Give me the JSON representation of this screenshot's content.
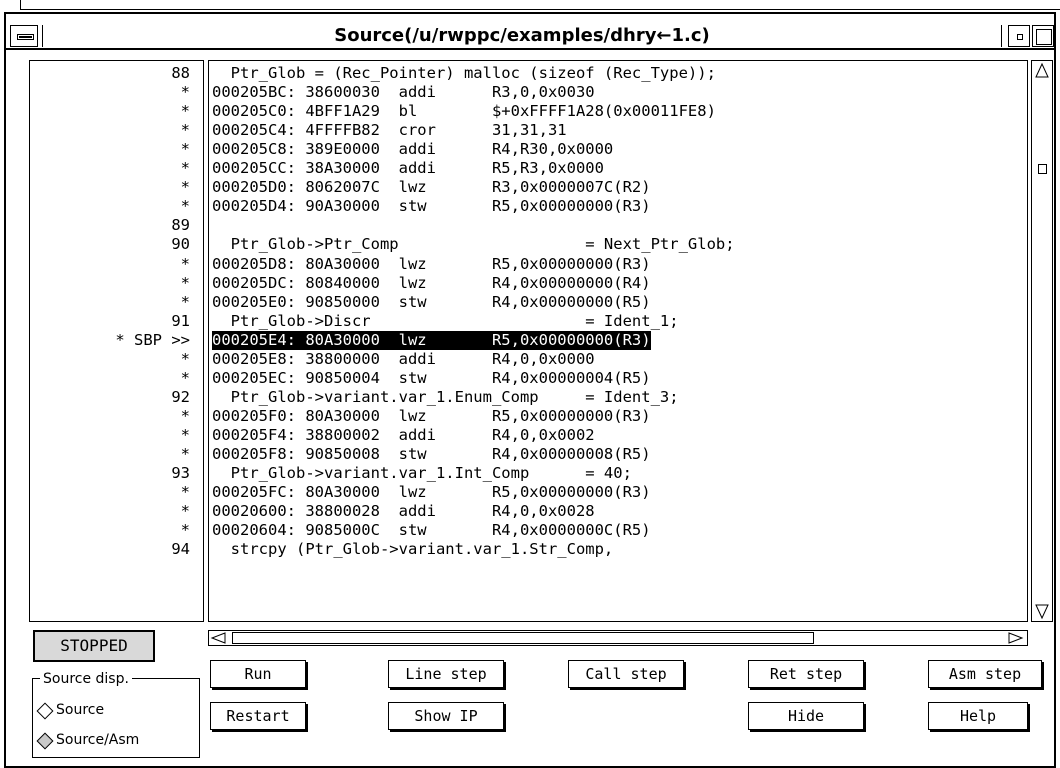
{
  "window": {
    "title": "Source(/u/rwppc/examples/dhry←1.c)"
  },
  "status": "STOPPED",
  "lines": [
    {
      "num": "88",
      "code": "  Ptr_Glob = (Rec_Pointer) malloc (sizeof (Rec_Type));"
    },
    {
      "num": "*",
      "code": "000205BC: 38600030  addi      R3,0,0x0030"
    },
    {
      "num": "*",
      "code": "000205C0: 4BFF1A29  bl        $+0xFFFF1A28(0x00011FE8)"
    },
    {
      "num": "*",
      "code": "000205C4: 4FFFFB82  cror      31,31,31"
    },
    {
      "num": "*",
      "code": "000205C8: 389E0000  addi      R4,R30,0x0000"
    },
    {
      "num": "*",
      "code": "000205CC: 38A30000  addi      R5,R3,0x0000"
    },
    {
      "num": "*",
      "code": "000205D0: 8062007C  lwz       R3,0x0000007C(R2)"
    },
    {
      "num": "*",
      "code": "000205D4: 90A30000  stw       R5,0x00000000(R3)"
    },
    {
      "num": "89",
      "code": ""
    },
    {
      "num": "90",
      "code": "  Ptr_Glob->Ptr_Comp                    = Next_Ptr_Glob;"
    },
    {
      "num": "*",
      "code": "000205D8: 80A30000  lwz       R5,0x00000000(R3)"
    },
    {
      "num": "*",
      "code": "000205DC: 80840000  lwz       R4,0x00000000(R4)"
    },
    {
      "num": "*",
      "code": "000205E0: 90850000  stw       R4,0x00000000(R5)"
    },
    {
      "num": "91",
      "code": "  Ptr_Glob->Discr                       = Ident_1;"
    },
    {
      "num": "* SBP >>",
      "code": "000205E4: 80A30000  lwz       R5,0x00000000(R3)",
      "highlight": true
    },
    {
      "num": "*",
      "code": "000205E8: 38800000  addi      R4,0,0x0000"
    },
    {
      "num": "*",
      "code": "000205EC: 90850004  stw       R4,0x00000004(R5)"
    },
    {
      "num": "92",
      "code": "  Ptr_Glob->variant.var_1.Enum_Comp     = Ident_3;"
    },
    {
      "num": "*",
      "code": "000205F0: 80A30000  lwz       R5,0x00000000(R3)"
    },
    {
      "num": "*",
      "code": "000205F4: 38800002  addi      R4,0,0x0002"
    },
    {
      "num": "*",
      "code": "000205F8: 90850008  stw       R4,0x00000008(R5)"
    },
    {
      "num": "93",
      "code": "  Ptr_Glob->variant.var_1.Int_Comp      = 40;"
    },
    {
      "num": "*",
      "code": "000205FC: 80A30000  lwz       R5,0x00000000(R3)"
    },
    {
      "num": "*",
      "code": "00020600: 38800028  addi      R4,0,0x0028"
    },
    {
      "num": "*",
      "code": "00020604: 9085000C  stw       R4,0x0000000C(R5)"
    },
    {
      "num": "94",
      "code": "  strcpy (Ptr_Glob->variant.var_1.Str_Comp,"
    }
  ],
  "buttons": {
    "run": "Run",
    "line_step": "Line step",
    "call_step": "Call step",
    "ret_step": "Ret step",
    "asm_step": "Asm step",
    "restart": "Restart",
    "show_ip": "Show IP",
    "hide": "Hide",
    "help": "Help"
  },
  "source_display": {
    "label": "Source disp.",
    "options": [
      "Source",
      "Source/Asm"
    ],
    "selected": "Source/Asm"
  }
}
